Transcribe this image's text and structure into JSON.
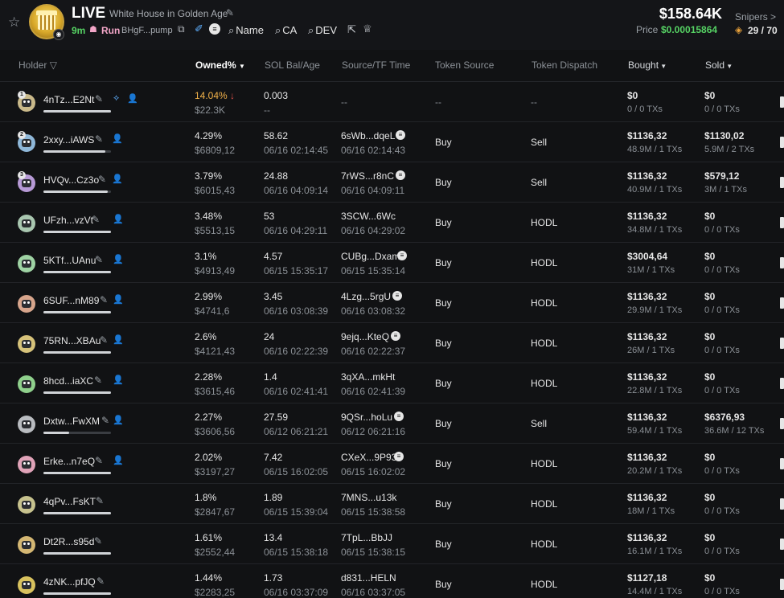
{
  "header": {
    "status": "LIVE",
    "token_name": "White House in Golden Age",
    "age": "9m",
    "run_label": "Run",
    "address": "BHgF...pump",
    "search_name": "Name",
    "search_ca": "CA",
    "search_dev": "DEV",
    "market_cap": "$158.64K",
    "price_label": "Price",
    "price_value": "$0.00015864",
    "snipers_label": "Snipers >",
    "snipers_value": "29 / 70"
  },
  "columns": {
    "holder": "Holder",
    "owned": "Owned%",
    "sol_bal": "SOL Bal/Age",
    "source": "Source/TF Time",
    "token_source": "Token Source",
    "token_dispatch": "Token Dispatch",
    "bought": "Bought",
    "sold": "Sold"
  },
  "rows": [
    {
      "rank": "1",
      "holder": "4nTz...E2Nt",
      "pct": "14.04%",
      "usd": "$22.3K",
      "sol": "0.003",
      "age": "--",
      "src": "--",
      "src_time": "",
      "tsrc": "--",
      "tdisp": "--",
      "bought": "$0",
      "bought_tx": "0 / 0 TXs",
      "sold": "$0",
      "sold_tx": "0 / 0 TXs",
      "bar": 1.0,
      "color": "#c9b98a"
    },
    {
      "rank": "2",
      "holder": "2xxy...iAWS",
      "pct": "4.29%",
      "usd": "$6809,12",
      "sol": "58.62",
      "age": "06/16 02:14:45",
      "src": "6sWb...dqeL",
      "src_time": "06/16 02:14:43",
      "tsrc": "Buy",
      "tdisp": "Sell",
      "bought": "$1136,32",
      "bought_tx": "48.9M / 1 TXs",
      "sold": "$1130,02",
      "sold_tx": "5.9M / 2 TXs",
      "bar": 0.92,
      "color": "#8fb8d9"
    },
    {
      "rank": "3",
      "holder": "HVQv...Cz3o",
      "pct": "3.79%",
      "usd": "$6015,43",
      "sol": "24.88",
      "age": "06/16 04:09:14",
      "src": "7rWS...r8nC",
      "src_time": "06/16 04:09:11",
      "tsrc": "Buy",
      "tdisp": "Sell",
      "bought": "$1136,32",
      "bought_tx": "40.9M / 1 TXs",
      "sold": "$579,12",
      "sold_tx": "3M / 1 TXs",
      "bar": 0.95,
      "color": "#b79ad6"
    },
    {
      "rank": "",
      "holder": "UFzh...vzVt",
      "pct": "3.48%",
      "usd": "$5513,15",
      "sol": "53",
      "age": "06/16 04:29:11",
      "src": "3SCW...6Wc",
      "src_time": "06/16 04:29:02",
      "tsrc": "Buy",
      "tdisp": "HODL",
      "bought": "$1136,32",
      "bought_tx": "34.8M / 1 TXs",
      "sold": "$0",
      "sold_tx": "0 / 0 TXs",
      "bar": 1.0,
      "color": "#a9c7b0"
    },
    {
      "rank": "",
      "holder": "5KTf...UAnu",
      "pct": "3.1%",
      "usd": "$4913,49",
      "sol": "4.57",
      "age": "06/15 15:35:17",
      "src": "CUBg...Dxam",
      "src_time": "06/15 15:35:14",
      "tsrc": "Buy",
      "tdisp": "HODL",
      "bought": "$3004,64",
      "bought_tx": "31M / 1 TXs",
      "sold": "$0",
      "sold_tx": "0 / 0 TXs",
      "bar": 1.0,
      "color": "#9fd3a4"
    },
    {
      "rank": "",
      "holder": "6SUF...nM89",
      "pct": "2.99%",
      "usd": "$4741,6",
      "sol": "3.45",
      "age": "06/16 03:08:39",
      "src": "4Lzg...5rgU",
      "src_time": "06/16 03:08:32",
      "tsrc": "Buy",
      "tdisp": "HODL",
      "bought": "$1136,32",
      "bought_tx": "29.9M / 1 TXs",
      "sold": "$0",
      "sold_tx": "0 / 0 TXs",
      "bar": 1.0,
      "color": "#d7a58c"
    },
    {
      "rank": "",
      "holder": "75RN...XBAu",
      "pct": "2.6%",
      "usd": "$4121,43",
      "sol": "24",
      "age": "06/16 02:22:39",
      "src": "9ejq...KteQ",
      "src_time": "06/16 02:22:37",
      "tsrc": "Buy",
      "tdisp": "HODL",
      "bought": "$1136,32",
      "bought_tx": "26M / 1 TXs",
      "sold": "$0",
      "sold_tx": "0 / 0 TXs",
      "bar": 1.0,
      "color": "#d6c27a"
    },
    {
      "rank": "",
      "holder": "8hcd...iaXC",
      "pct": "2.28%",
      "usd": "$3615,46",
      "sol": "1.4",
      "age": "06/16 02:41:41",
      "src": "3qXA...mkHt",
      "src_time": "06/16 02:41:39",
      "tsrc": "Buy",
      "tdisp": "HODL",
      "bought": "$1136,32",
      "bought_tx": "22.8M / 1 TXs",
      "sold": "$0",
      "sold_tx": "0 / 0 TXs",
      "bar": 1.0,
      "color": "#8fd08c"
    },
    {
      "rank": "",
      "holder": "Dxtw...FwXM",
      "pct": "2.27%",
      "usd": "$3606,56",
      "sol": "27.59",
      "age": "06/12 06:21:21",
      "src": "9QSr...hoLu",
      "src_time": "06/12 06:21:16",
      "tsrc": "Buy",
      "tdisp": "Sell",
      "bought": "$1136,32",
      "bought_tx": "59.4M / 1 TXs",
      "sold": "$6376,93",
      "sold_tx": "36.6M / 12 TXs",
      "bar": 0.38,
      "color": "#b9bcc0"
    },
    {
      "rank": "",
      "holder": "Erke...n7eQ",
      "pct": "2.02%",
      "usd": "$3197,27",
      "sol": "7.42",
      "age": "06/15 16:02:05",
      "src": "CXeX...9P93",
      "src_time": "06/15 16:02:02",
      "tsrc": "Buy",
      "tdisp": "HODL",
      "bought": "$1136,32",
      "bought_tx": "20.2M / 1 TXs",
      "sold": "$0",
      "sold_tx": "0 / 0 TXs",
      "bar": 1.0,
      "color": "#e0a3b8"
    },
    {
      "rank": "",
      "holder": "4qPv...FsKT",
      "pct": "1.8%",
      "usd": "$2847,67",
      "sol": "1.89",
      "age": "06/15 15:39:04",
      "src": "7MNS...u13k",
      "src_time": "06/15 15:38:58",
      "tsrc": "Buy",
      "tdisp": "HODL",
      "bought": "$1136,32",
      "bought_tx": "18M / 1 TXs",
      "sold": "$0",
      "sold_tx": "0 / 0 TXs",
      "bar": 1.0,
      "color": "#c7c28e"
    },
    {
      "rank": "",
      "holder": "Dt2R...s95d",
      "pct": "1.61%",
      "usd": "$2552,44",
      "sol": "13.4",
      "age": "06/15 15:38:18",
      "src": "7TpL...BbJJ",
      "src_time": "06/15 15:38:15",
      "tsrc": "Buy",
      "tdisp": "HODL",
      "bought": "$1136,32",
      "bought_tx": "16.1M / 1 TXs",
      "sold": "$0",
      "sold_tx": "0 / 0 TXs",
      "bar": 1.0,
      "color": "#d4b773"
    },
    {
      "rank": "",
      "holder": "4zNK...pfJQ",
      "pct": "1.44%",
      "usd": "$2283,25",
      "sol": "1.73",
      "age": "06/16 03:37:09",
      "src": "d831...HELN",
      "src_time": "06/16 03:37:05",
      "tsrc": "Buy",
      "tdisp": "HODL",
      "bought": "$1127,18",
      "bought_tx": "14.4M / 1 TXs",
      "sold": "$0",
      "sold_tx": "0 / 0 TXs",
      "bar": 1.0,
      "color": "#d8c25e"
    }
  ],
  "icons": {
    "star": "star-icon",
    "edit": "pencil-icon",
    "copy": "copy-icon",
    "search": "search-icon",
    "external": "external-link-icon",
    "crown": "crown-icon",
    "person": "person-icon",
    "sort": "caret-down-icon",
    "filter": "filter-icon",
    "down_arrow": "arrow-down-icon"
  },
  "colors": {
    "green": "#56d364",
    "orange": "#f2b24a",
    "red": "#e5534b",
    "pink": "#f3a6c8",
    "blue": "#5fb0ff"
  }
}
